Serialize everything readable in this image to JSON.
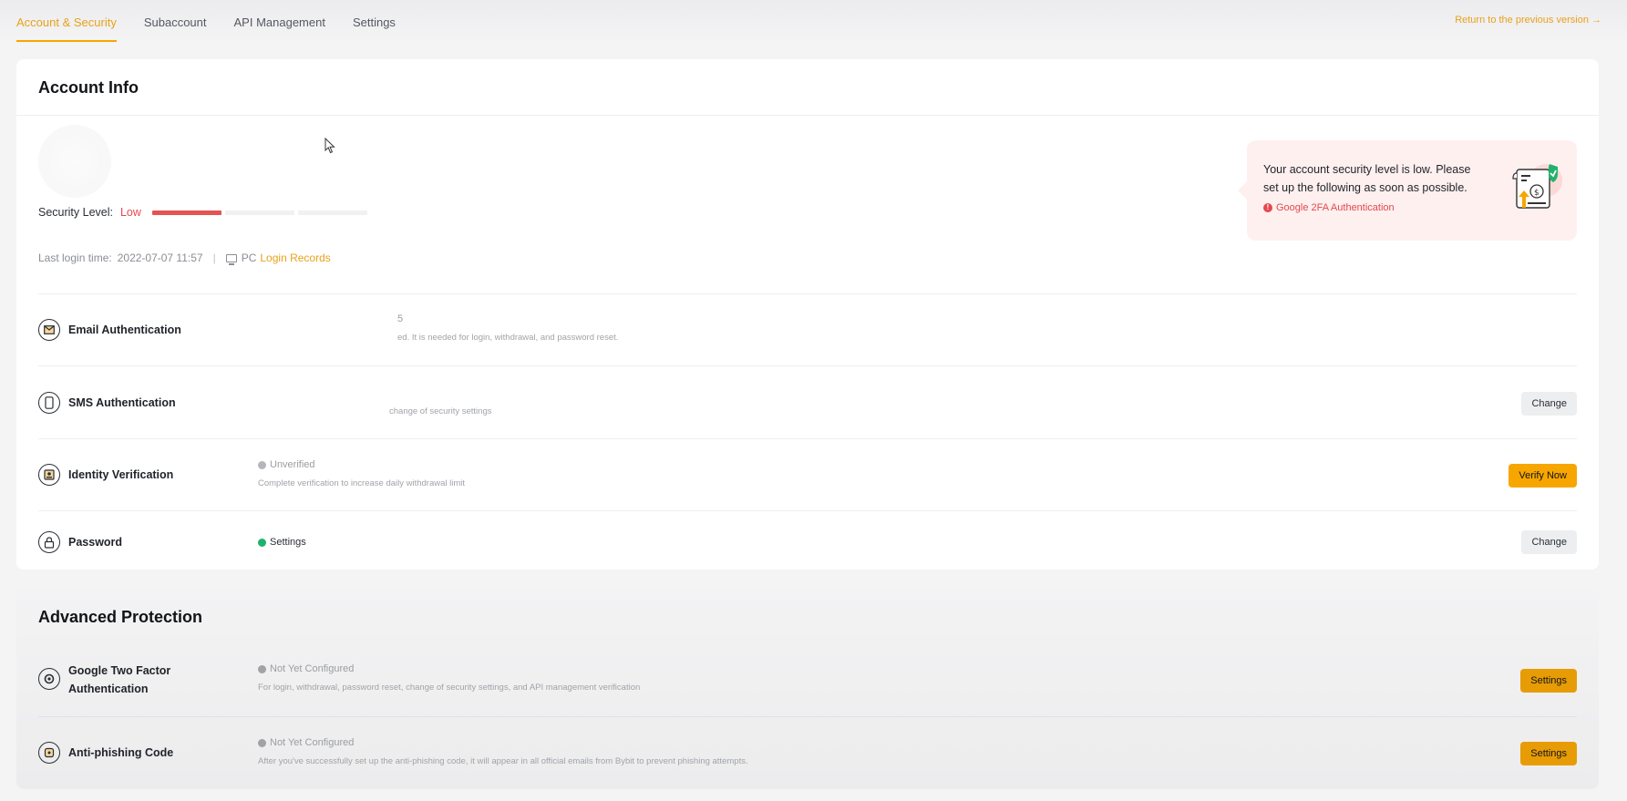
{
  "tabs": [
    {
      "label": "Account & Security",
      "active": true
    },
    {
      "label": "Subaccount",
      "active": false
    },
    {
      "label": "API Management",
      "active": false
    },
    {
      "label": "Settings",
      "active": false
    }
  ],
  "return_link": "Return to the previous version →",
  "account_info": {
    "title": "Account Info",
    "security_level_label": "Security Level:",
    "security_level_value": "Low",
    "security_level_segments_filled": 1,
    "security_level_segments_total": 3,
    "last_login_label": "Last login time:",
    "last_login_value": "2022-07-07 11:57",
    "separator": "|",
    "device": "PC",
    "login_records": "Login Records"
  },
  "alert": {
    "text": "Your account security level is low. Please set up the following as soon as possible.",
    "item": "Google 2FA Authentication",
    "item_icon": "!"
  },
  "rows": {
    "email": {
      "label": "Email Authentication",
      "status": "5",
      "desc": "ed. It is needed for login, withdrawal, and password reset."
    },
    "sms": {
      "label": "SMS Authentication",
      "desc": "change of security settings",
      "button": "Change"
    },
    "identity": {
      "label": "Identity Verification",
      "status": "Unverified",
      "desc": "Complete verification to increase daily withdrawal limit",
      "button": "Verify Now"
    },
    "password": {
      "label": "Password",
      "status": "Settings",
      "button": "Change"
    }
  },
  "advanced": {
    "title": "Advanced Protection",
    "google2fa": {
      "label_line1": "Google Two Factor",
      "label_line2": "Authentication",
      "status": "Not Yet Configured",
      "desc": "For login, withdrawal, password reset, change of security settings, and API management verification",
      "button": "Settings"
    },
    "antiphishing": {
      "label": "Anti-phishing Code",
      "status": "Not Yet Configured",
      "desc": "After you've successfully set up the anti-phishing code, it will appear in all official emails from Bybit to prevent phishing attempts.",
      "button": "Settings"
    }
  },
  "colors": {
    "accent": "#f7a600",
    "danger": "#e5484d",
    "success": "#20b26c"
  }
}
